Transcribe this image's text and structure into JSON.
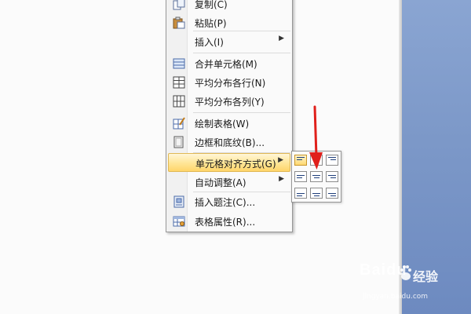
{
  "context_menu": {
    "items": [
      {
        "label": "复制(C)",
        "icon": "copy-icon"
      },
      {
        "label": "粘贴(P)",
        "icon": "paste-icon"
      },
      {
        "label": "插入(I)",
        "has_submenu": true
      },
      {
        "label": "合并单元格(M)",
        "icon": "merge-cells-icon"
      },
      {
        "label": "平均分布各行(N)",
        "icon": "distribute-rows-icon"
      },
      {
        "label": "平均分布各列(Y)",
        "icon": "distribute-columns-icon"
      },
      {
        "label": "绘制表格(W)",
        "icon": "draw-table-icon"
      },
      {
        "label": "边框和底纹(B)...",
        "icon": "borders-shading-icon"
      },
      {
        "label": "单元格对齐方式(G)",
        "has_submenu": true,
        "highlighted": true
      },
      {
        "label": "自动调整(A)",
        "has_submenu": true
      },
      {
        "label": "插入题注(C)...",
        "icon": "insert-caption-icon"
      },
      {
        "label": "表格属性(R)...",
        "icon": "table-properties-icon"
      }
    ]
  },
  "alignment_submenu": {
    "options": [
      {
        "name": "top-left",
        "selected": true
      },
      {
        "name": "top-center",
        "selected": false
      },
      {
        "name": "top-right",
        "selected": false
      },
      {
        "name": "middle-left",
        "selected": false
      },
      {
        "name": "middle-center",
        "selected": false
      },
      {
        "name": "middle-right",
        "selected": false
      },
      {
        "name": "bottom-left",
        "selected": false
      },
      {
        "name": "bottom-center",
        "selected": false
      },
      {
        "name": "bottom-right",
        "selected": false
      }
    ]
  },
  "watermark": {
    "brand": "Baidu",
    "product": "经验",
    "url": "jingyan.baidu.com"
  },
  "colors": {
    "highlight": "#ffd56a",
    "annotation_arrow": "#e0201b",
    "app_background": "#7c98c8"
  }
}
